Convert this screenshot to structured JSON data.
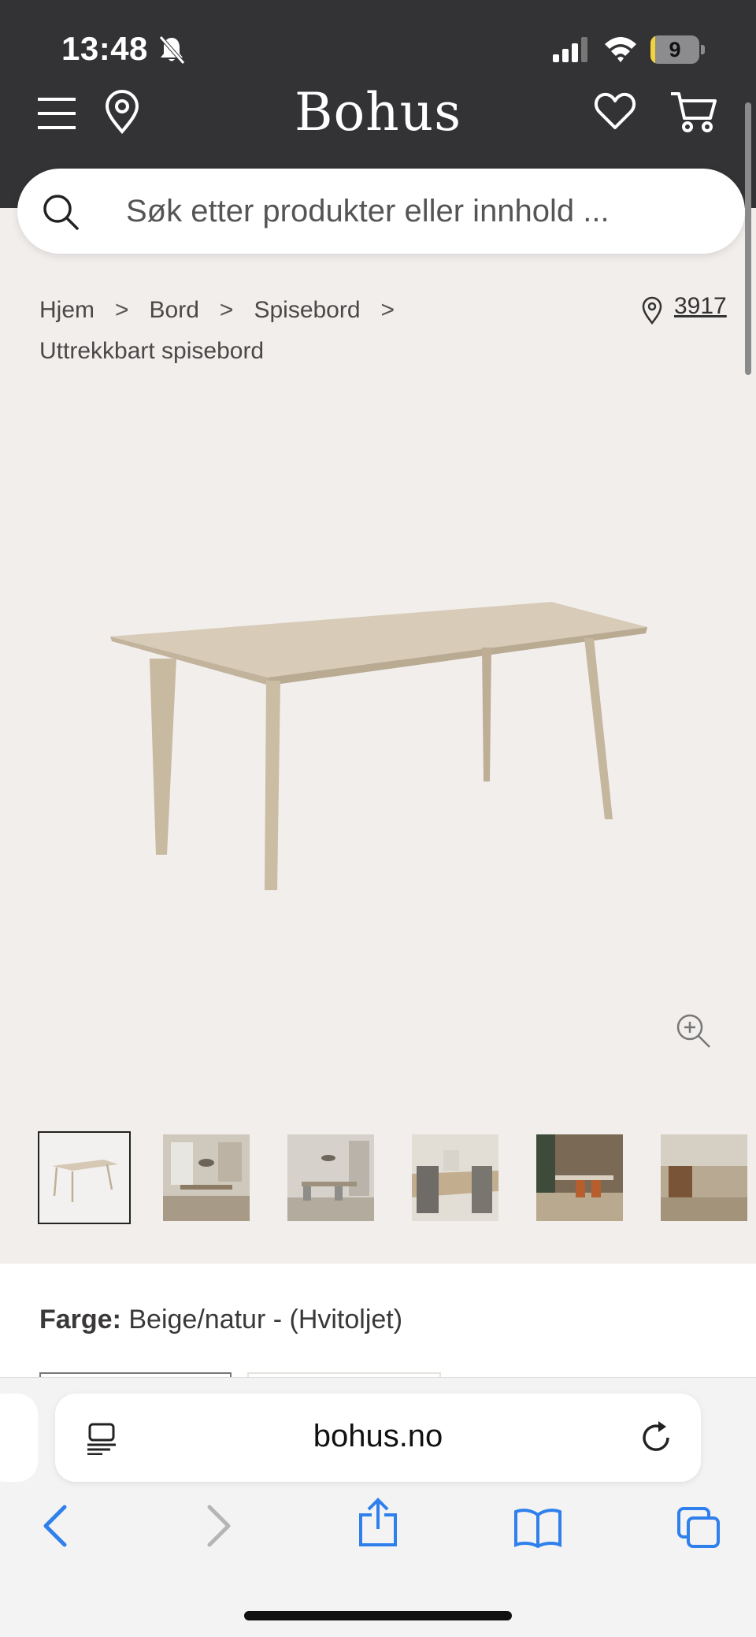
{
  "status": {
    "time": "13:48",
    "battery": "9",
    "battery_level_percent": 9,
    "icons": [
      "silent-bell-icon",
      "signal-icon",
      "wifi-icon",
      "battery-icon"
    ]
  },
  "header": {
    "logo": "Bohus",
    "icons": [
      "menu-icon",
      "location-pin-icon",
      "heart-icon",
      "cart-icon"
    ],
    "background": "#333336"
  },
  "search": {
    "placeholder": "Søk etter produkter eller innhold ..."
  },
  "breadcrumb": {
    "items": [
      "Hjem",
      "Bord",
      "Spisebord",
      "Uttrekkbart spisebord"
    ],
    "store": "3917"
  },
  "product": {
    "image_icon": "dining-table-image",
    "zoom_icon": "zoom-in-icon",
    "thumbnails": [
      {
        "label": "table-product-shot"
      },
      {
        "label": "dining-room-photo-1"
      },
      {
        "label": "dining-room-photo-2"
      },
      {
        "label": "table-closeup-photo"
      },
      {
        "label": "dining-room-photo-3"
      },
      {
        "label": "dining-room-photo-4"
      }
    ],
    "color_label": "Farge:",
    "color_value": "Beige/natur - (Hvitoljet)"
  },
  "browser": {
    "url": "bohus.no",
    "icons": [
      "reader-icon",
      "reload-icon",
      "back-icon",
      "forward-icon",
      "share-icon",
      "bookmarks-icon",
      "tabs-icon"
    ],
    "accent": "#2f80ed"
  },
  "colors": {
    "page_bg": "#f1eeec",
    "header_bg": "#333336",
    "wood": "#cfc1aa"
  }
}
